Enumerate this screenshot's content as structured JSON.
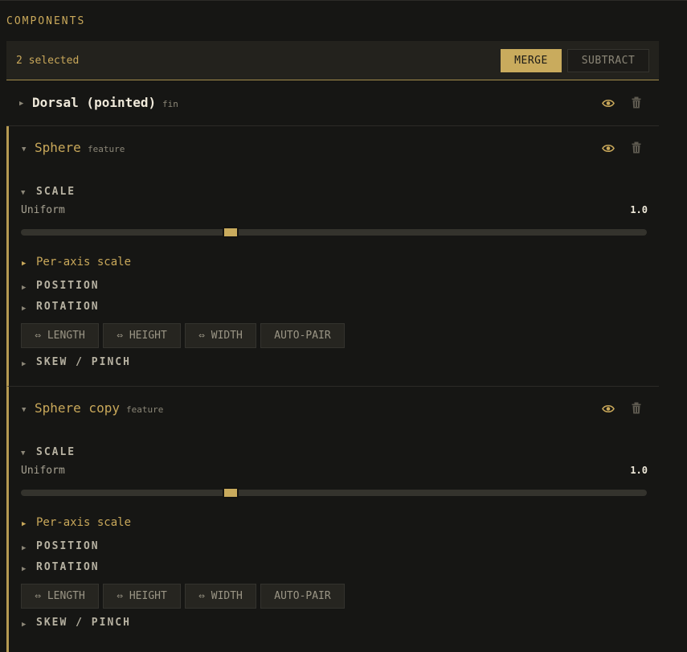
{
  "section_title": "COMPONENTS",
  "toolbar": {
    "selection_count": "2 selected",
    "merge_label": "MERGE",
    "subtract_label": "SUBTRACT"
  },
  "colors": {
    "accent": "#c9ab5d",
    "background": "#161614",
    "text": "#e6e1d3"
  },
  "components": [
    {
      "name": "Dorsal (pointed)",
      "type": "fin",
      "expanded": false,
      "selected": false,
      "icons": [
        "eye-icon",
        "trash-icon"
      ]
    },
    {
      "name": "Sphere",
      "type": "feature",
      "expanded": true,
      "selected": true,
      "scale_label": "SCALE",
      "uniform_label": "Uniform",
      "uniform_value": "1.0",
      "slider_fraction": 0.335,
      "per_axis_label": "Per-axis scale",
      "position_label": "POSITION",
      "rotation_label": "ROTATION",
      "chips": [
        "⇔ LENGTH",
        "⇔ HEIGHT",
        "⇔ WIDTH",
        "AUTO-PAIR"
      ],
      "skew_label": "SKEW / PINCH",
      "icons": [
        "eye-icon",
        "trash-icon"
      ]
    },
    {
      "name": "Sphere copy",
      "type": "feature",
      "expanded": true,
      "selected": true,
      "scale_label": "SCALE",
      "uniform_label": "Uniform",
      "uniform_value": "1.0",
      "slider_fraction": 0.335,
      "per_axis_label": "Per-axis scale",
      "position_label": "POSITION",
      "rotation_label": "ROTATION",
      "chips": [
        "⇔ LENGTH",
        "⇔ HEIGHT",
        "⇔ WIDTH",
        "AUTO-PAIR"
      ],
      "skew_label": "SKEW / PINCH",
      "icons": [
        "eye-icon",
        "trash-icon"
      ]
    }
  ]
}
